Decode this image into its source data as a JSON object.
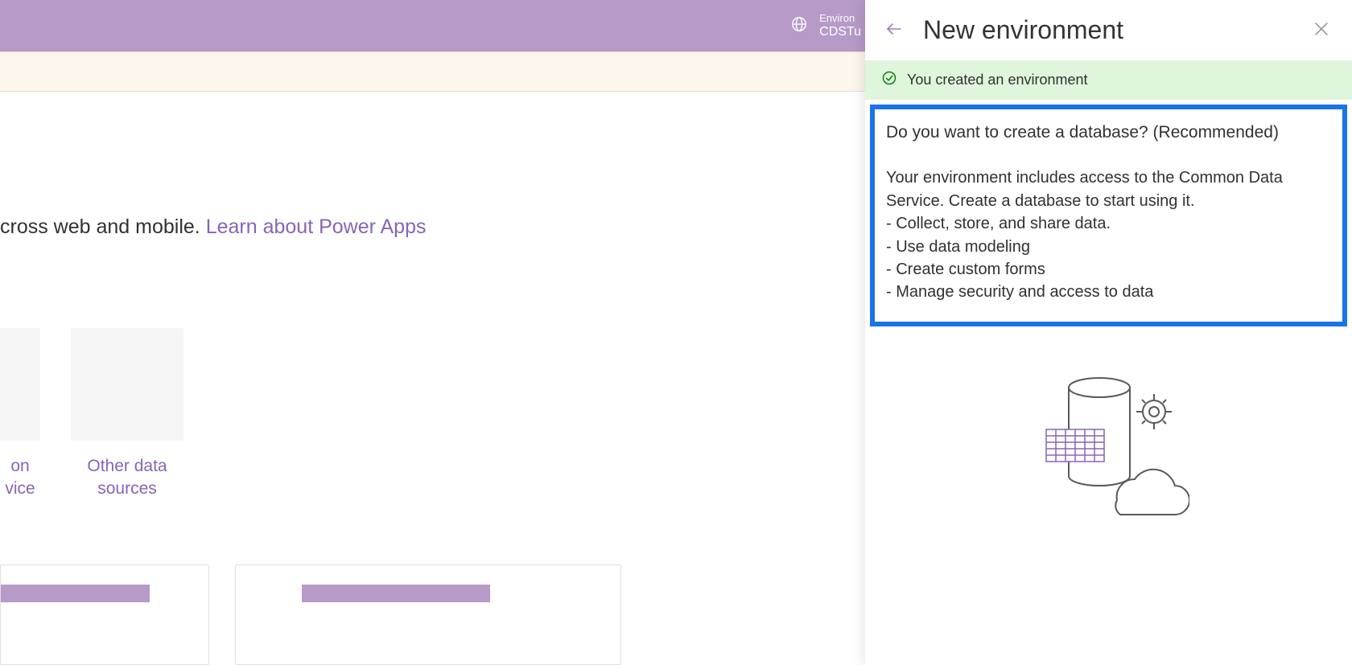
{
  "header": {
    "environment_label": "Environ",
    "environment_name": "CDSTu"
  },
  "main": {
    "text_prefix": "cross web and mobile. ",
    "learn_link": "Learn about Power Apps",
    "tiles": [
      {
        "label_line1": "on",
        "label_line2": "vice"
      },
      {
        "label_line1": "Other data",
        "label_line2": "sources"
      }
    ]
  },
  "panel": {
    "title": "New environment",
    "success_message": "You created an environment",
    "question": "Do you want to create a database? (Recommended)",
    "description": "Your environment includes access to the Common Data Service. Create a database to start using it.",
    "bullets": [
      "- Collect, store, and share data.",
      "- Use data modeling",
      "- Create custom forms",
      "- Manage security and access to data"
    ]
  }
}
